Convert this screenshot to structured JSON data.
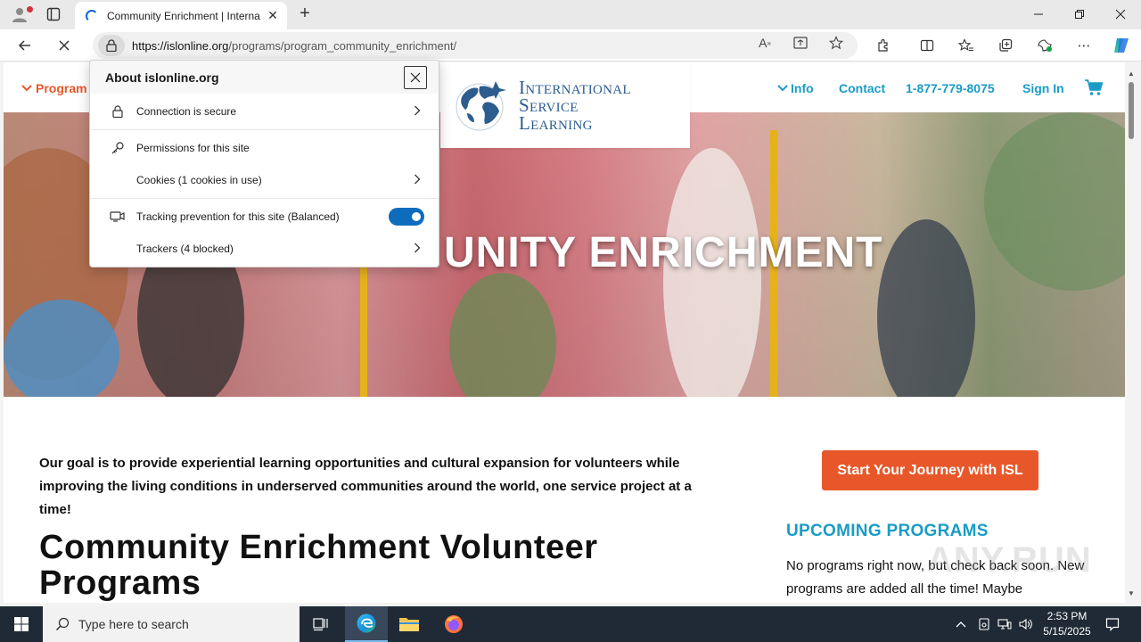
{
  "browser": {
    "tab_title": "Community Enrichment | Internati",
    "new_tab_label": "+",
    "url_host": "https://islonline.org",
    "url_path": "/programs/program_community_enrichment/"
  },
  "popup": {
    "title": "About islonline.org",
    "connection": "Connection is secure",
    "permissions": "Permissions for this site",
    "cookies": "Cookies (1 cookies in use)",
    "tracking": "Tracking prevention for this site (Balanced)",
    "tracking_enabled": true,
    "trackers": "Trackers (4 blocked)"
  },
  "site": {
    "header": {
      "programs": "Program",
      "logo_line1": "International",
      "logo_line2": "Service",
      "logo_line3": "Learning",
      "info": "Info",
      "contact": "Contact",
      "phone": "1-877-779-8075",
      "sign_in": "Sign In"
    },
    "hero_title": "UNITY ENRICHMENT",
    "intro": "Our goal is to provide experiential learning opportunities and cultural expansion for volunteers while improving the living conditions in underserved communities around the world, one service project at a time!",
    "heading": "Community Enrichment Volunteer Programs",
    "cta": "Start Your Journey with ISL",
    "upcoming_title": "UPCOMING PROGRAMS",
    "upcoming_text": "No programs right now, but check back soon. New programs are added all the time! Maybe"
  },
  "taskbar": {
    "search_placeholder": "Type here to search",
    "time": "2:53 PM",
    "date": "5/15/2025"
  },
  "watermark": "ANY.RUN",
  "colors": {
    "accent_orange": "#e8572a",
    "accent_teal": "#1a9cc7",
    "logo_blue": "#2d5c8e",
    "toggle_blue": "#0f6cbd"
  }
}
